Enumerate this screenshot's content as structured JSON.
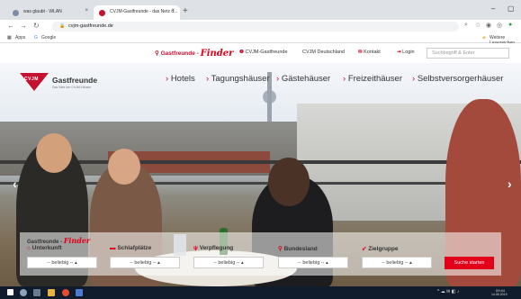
{
  "browser": {
    "tabs": [
      {
        "title": "was glaubt - WLAN",
        "active": false
      },
      {
        "title": "CVJM-Gastfreunde - das Netz d...",
        "active": true
      }
    ],
    "new_tab": "+",
    "window_controls": {
      "minimize": "–",
      "maximize": "▢"
    },
    "url": "cvjm-gastfreunde.de",
    "bookmarks": {
      "apps": "Apps",
      "google": "Google",
      "other": "Weitere Lesezeichen"
    }
  },
  "site": {
    "topnav": {
      "brand_prefix": "Gastfreunde - ",
      "brand_finder": "Finder",
      "links": [
        "CVJM-Gastfreunde",
        "CVJM Deutschland",
        "Kontakt",
        "Login"
      ],
      "search_placeholder": "Suchbegriff & Enter"
    },
    "logo": {
      "mark": "CVJM",
      "name": "Gastfreunde",
      "subtitle": "Das Netz der CVJM-Häuser"
    },
    "categories": [
      "Hotels",
      "Tagungshäuser",
      "Gästehäuser",
      "Freizeithäuser",
      "Selbstversorgerhäuser"
    ],
    "finder": {
      "title_prefix": "Gastfreunde - ",
      "title_finder": "Finder",
      "filters": [
        {
          "label": "Unterkunft",
          "icon": "home-icon",
          "value": "-- beliebig -- ▴"
        },
        {
          "label": "Schlafplätze",
          "icon": "bed-icon",
          "value": "-- beliebig -- ▴"
        },
        {
          "label": "Verpflegung",
          "icon": "cutlery-icon",
          "value": "-- beliebig -- ▴"
        },
        {
          "label": "Bundesland",
          "icon": "location-pin-icon",
          "value": "-- beliebig -- ▴"
        },
        {
          "label": "Zielgruppe",
          "icon": "target-icon",
          "value": "-- beliebig -- ▴"
        }
      ],
      "search_button": "Suche starten"
    }
  },
  "taskbar": {
    "time": "09:44",
    "date": "14.05.2019"
  },
  "colors": {
    "brand_red": "#e2001a",
    "dark_red": "#c4122f",
    "taskbar": "#101c2c"
  }
}
